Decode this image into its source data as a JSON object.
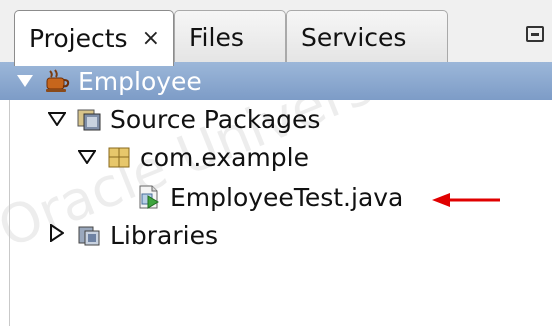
{
  "tabs": [
    {
      "label": "Projects",
      "close": "×"
    },
    {
      "label": "Files"
    },
    {
      "label": "Services"
    }
  ],
  "tree": {
    "project": "Employee",
    "source_packages": "Source Packages",
    "package": "com.example",
    "file": "EmployeeTest.java",
    "libraries": "Libraries"
  },
  "watermark": "Oracle University and",
  "colors": {
    "selection": "#8aa8d1",
    "arrow": "#e00000"
  }
}
